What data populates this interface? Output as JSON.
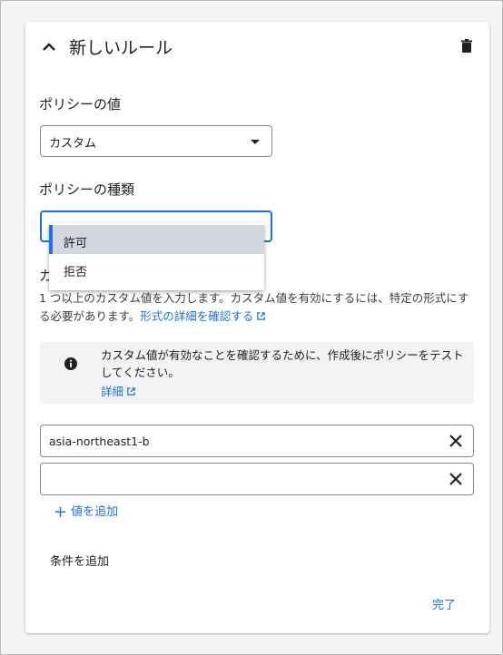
{
  "rule": {
    "title": "新しいルール"
  },
  "policy_value": {
    "label": "ポリシーの値",
    "selected": "カスタム"
  },
  "policy_type": {
    "label": "ポリシーの種類",
    "selected": "",
    "options": [
      "許可",
      "拒否"
    ]
  },
  "custom_values": {
    "label_visible_fragment": "カ",
    "helper_text": "1 つ以上のカスタム値を入力します。カスタム値を有効にするには、特定の形式にする必要があります。",
    "helper_link": "形式の詳細を確認する"
  },
  "info": {
    "text": "カスタム値が有効なことを確認するために、作成後にポリシーをテストしてください。",
    "link": "詳細"
  },
  "fields": [
    {
      "value": "asia-northeast1-b",
      "placeholder": ""
    },
    {
      "value": "",
      "placeholder": ""
    }
  ],
  "actions": {
    "add_value": "値を追加",
    "add_condition": "条件を追加",
    "done": "完了"
  },
  "colors": {
    "accent": "#1a73e8",
    "selected_option_bg": "#d1d6df",
    "info_bg": "#f1f3f4"
  },
  "icons": [
    "chevron-up-icon",
    "trash-icon",
    "caret-down-icon",
    "info-icon",
    "external-link-icon",
    "close-icon",
    "plus-icon"
  ]
}
